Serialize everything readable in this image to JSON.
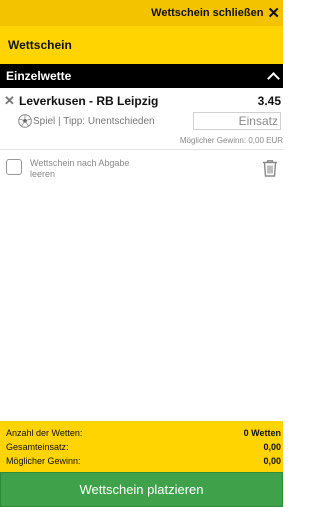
{
  "topbar": {
    "close_label": "Wettschein schließen",
    "close_icon": "close-icon"
  },
  "header": {
    "title": "Wettschein"
  },
  "section": {
    "title": "Einzelwette",
    "icon": "chevron-up-icon"
  },
  "bet": {
    "match": "Leverkusen - RB Leipzig",
    "odds": "3.45",
    "tip": "Spiel | Tipp: Unentschieden",
    "stake_placeholder": "Einsatz",
    "possible_win": "Möglicher Gewinn: 0,00 EUR",
    "sport_icon": "soccer-ball-icon",
    "remove_icon": "close-icon"
  },
  "clear_option": {
    "label": "Wettschein nach Abgabe leeren",
    "checked": false,
    "trash_icon": "trash-icon"
  },
  "summary": {
    "rows": [
      {
        "label": "Anzahl der Wetten:",
        "value": "0 Wetten"
      },
      {
        "label": "Gesamteinsatz:",
        "value": "0,00"
      },
      {
        "label": "Möglicher Gewinn:",
        "value": "0,00"
      }
    ]
  },
  "place_button": {
    "label": "Wettschein platzieren"
  },
  "colors": {
    "topbar": "#f3c300",
    "header": "#ffd400",
    "section": "#000000",
    "button": "#3fa24a"
  }
}
